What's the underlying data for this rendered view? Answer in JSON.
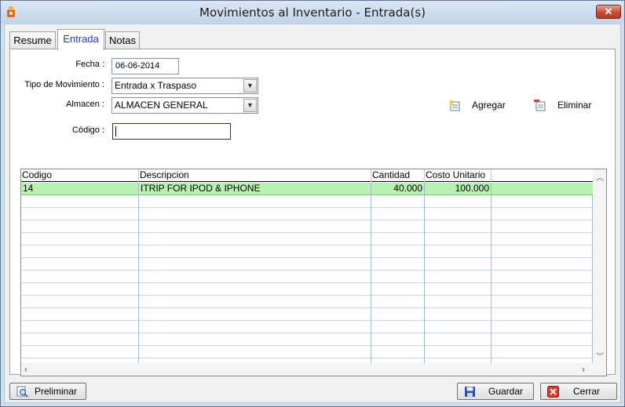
{
  "window": {
    "title": "Movimientos al Inventario - Entrada(s)",
    "close_label": "✕"
  },
  "tabs": [
    {
      "label": "Resume",
      "active": false
    },
    {
      "label": "Entrada",
      "active": true
    },
    {
      "label": "Notas",
      "active": false
    }
  ],
  "form": {
    "fecha_label": "Fecha :",
    "fecha_value": "06-06-2014",
    "tipo_label": "Tipo de Movimiento :",
    "tipo_value": "Entrada x Traspaso",
    "almacen_label": "Almacen :",
    "almacen_value": "ALMACEN GENERAL",
    "codigo_label": "Código :",
    "codigo_value": ""
  },
  "actions": {
    "agregar_label": "Agregar",
    "eliminar_label": "Eliminar"
  },
  "grid": {
    "columns": [
      "Codigo",
      "Descripcion",
      "Cantidad",
      "Costo Unitario"
    ],
    "rows": [
      {
        "codigo": "14",
        "descripcion": "ITRIP FOR IPOD & IPHONE",
        "cantidad": "40.000",
        "costo": "100.000",
        "selected": true
      }
    ],
    "empty_rows": 14
  },
  "footer": {
    "preliminar_label": "Preliminar",
    "guardar_label": "Guardar",
    "cerrar_label": "Cerrar"
  },
  "colors": {
    "selected_row": "#b6f2b0",
    "active_tab_text": "#1f39c8",
    "title_bar": "#c4d5ea"
  }
}
